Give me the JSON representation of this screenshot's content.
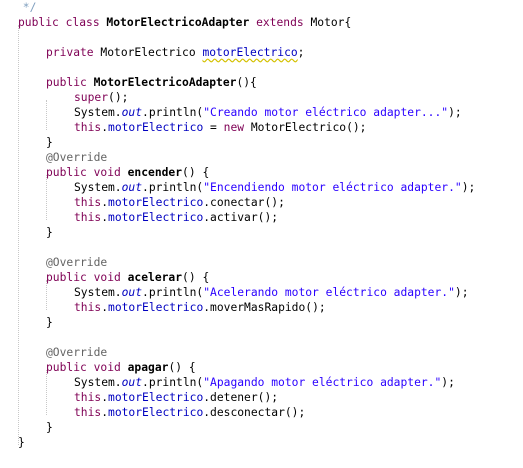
{
  "editor": {
    "lines": [
      {
        "indent": 0,
        "tokens": [
          {
            "t": " */",
            "c": "comment"
          }
        ]
      },
      {
        "indent": 0,
        "tokens": [
          {
            "t": "public class ",
            "c": "kw-plain"
          },
          {
            "t": "MotorElectricoAdapter",
            "c": "cls"
          },
          {
            "t": " ",
            "c": "plain"
          },
          {
            "t": "extends",
            "c": "kw-plain"
          },
          {
            "t": " Motor{",
            "c": "plain"
          }
        ]
      },
      {
        "indent": 0,
        "tokens": []
      },
      {
        "indent": 1,
        "tokens": [
          {
            "t": "private ",
            "c": "kw-plain"
          },
          {
            "t": "MotorElectrico ",
            "c": "plain"
          },
          {
            "t": "motorElectrico",
            "c": "field-warn"
          },
          {
            "t": ";",
            "c": "plain"
          }
        ]
      },
      {
        "indent": 0,
        "tokens": []
      },
      {
        "indent": 1,
        "tokens": [
          {
            "t": "public ",
            "c": "kw-plain"
          },
          {
            "t": "MotorElectricoAdapter",
            "c": "bold"
          },
          {
            "t": "(){",
            "c": "plain"
          }
        ]
      },
      {
        "indent": 2,
        "tokens": [
          {
            "t": "super",
            "c": "kw-plain"
          },
          {
            "t": "();",
            "c": "plain"
          }
        ]
      },
      {
        "indent": 2,
        "tokens": [
          {
            "t": "System.",
            "c": "plain"
          },
          {
            "t": "out",
            "c": "static"
          },
          {
            "t": ".println(",
            "c": "plain"
          },
          {
            "t": "\"Creando motor eléctrico adapter...\"",
            "c": "str"
          },
          {
            "t": ");",
            "c": "plain"
          }
        ]
      },
      {
        "indent": 2,
        "tokens": [
          {
            "t": "this",
            "c": "kw-plain"
          },
          {
            "t": ".",
            "c": "plain"
          },
          {
            "t": "motorElectrico",
            "c": "field"
          },
          {
            "t": " = ",
            "c": "plain"
          },
          {
            "t": "new",
            "c": "kw-plain"
          },
          {
            "t": " MotorElectrico();",
            "c": "plain"
          }
        ]
      },
      {
        "indent": 1,
        "tokens": [
          {
            "t": "}",
            "c": "plain"
          }
        ]
      },
      {
        "indent": 1,
        "tokens": [
          {
            "t": "@Override",
            "c": "ann"
          }
        ]
      },
      {
        "indent": 1,
        "tokens": [
          {
            "t": "public ",
            "c": "kw-plain"
          },
          {
            "t": "void ",
            "c": "kw-plain"
          },
          {
            "t": "encender",
            "c": "bold"
          },
          {
            "t": "() {",
            "c": "plain"
          }
        ]
      },
      {
        "indent": 2,
        "tokens": [
          {
            "t": "System.",
            "c": "plain"
          },
          {
            "t": "out",
            "c": "static"
          },
          {
            "t": ".println(",
            "c": "plain"
          },
          {
            "t": "\"Encendiendo motor eléctrico adapter.\"",
            "c": "str"
          },
          {
            "t": ");",
            "c": "plain"
          }
        ]
      },
      {
        "indent": 2,
        "tokens": [
          {
            "t": "this",
            "c": "kw-plain"
          },
          {
            "t": ".",
            "c": "plain"
          },
          {
            "t": "motorElectrico",
            "c": "field"
          },
          {
            "t": ".conectar();",
            "c": "plain"
          }
        ]
      },
      {
        "indent": 2,
        "tokens": [
          {
            "t": "this",
            "c": "kw-plain"
          },
          {
            "t": ".",
            "c": "plain"
          },
          {
            "t": "motorElectrico",
            "c": "field"
          },
          {
            "t": ".activar();",
            "c": "plain"
          }
        ]
      },
      {
        "indent": 1,
        "tokens": [
          {
            "t": "}",
            "c": "plain"
          }
        ]
      },
      {
        "indent": 0,
        "tokens": []
      },
      {
        "indent": 1,
        "tokens": [
          {
            "t": "@Override",
            "c": "ann"
          }
        ]
      },
      {
        "indent": 1,
        "tokens": [
          {
            "t": "public ",
            "c": "kw-plain"
          },
          {
            "t": "void ",
            "c": "kw-plain"
          },
          {
            "t": "acelerar",
            "c": "bold"
          },
          {
            "t": "() {",
            "c": "plain"
          }
        ]
      },
      {
        "indent": 2,
        "tokens": [
          {
            "t": "System.",
            "c": "plain"
          },
          {
            "t": "out",
            "c": "static"
          },
          {
            "t": ".println(",
            "c": "plain"
          },
          {
            "t": "\"Acelerando motor eléctrico adapter.\"",
            "c": "str"
          },
          {
            "t": ");",
            "c": "plain"
          }
        ]
      },
      {
        "indent": 2,
        "tokens": [
          {
            "t": "this",
            "c": "kw-plain"
          },
          {
            "t": ".",
            "c": "plain"
          },
          {
            "t": "motorElectrico",
            "c": "field"
          },
          {
            "t": ".moverMasRapido();",
            "c": "plain"
          }
        ]
      },
      {
        "indent": 1,
        "tokens": [
          {
            "t": "}",
            "c": "plain"
          }
        ]
      },
      {
        "indent": 0,
        "tokens": []
      },
      {
        "indent": 1,
        "tokens": [
          {
            "t": "@Override",
            "c": "ann"
          }
        ]
      },
      {
        "indent": 1,
        "tokens": [
          {
            "t": "public ",
            "c": "kw-plain"
          },
          {
            "t": "void ",
            "c": "kw-plain"
          },
          {
            "t": "apagar",
            "c": "bold"
          },
          {
            "t": "() {",
            "c": "plain"
          }
        ]
      },
      {
        "indent": 2,
        "tokens": [
          {
            "t": "System.",
            "c": "plain"
          },
          {
            "t": "out",
            "c": "static"
          },
          {
            "t": ".println(",
            "c": "plain"
          },
          {
            "t": "\"Apagando motor eléctrico adapter.\"",
            "c": "str"
          },
          {
            "t": ");",
            "c": "plain"
          }
        ]
      },
      {
        "indent": 2,
        "tokens": [
          {
            "t": "this",
            "c": "kw-plain"
          },
          {
            "t": ".",
            "c": "plain"
          },
          {
            "t": "motorElectrico",
            "c": "field"
          },
          {
            "t": ".detener();",
            "c": "plain"
          }
        ]
      },
      {
        "indent": 2,
        "tokens": [
          {
            "t": "this",
            "c": "kw-plain"
          },
          {
            "t": ".",
            "c": "plain"
          },
          {
            "t": "motorElectrico",
            "c": "field"
          },
          {
            "t": ".desconectar();",
            "c": "plain"
          }
        ]
      },
      {
        "indent": 1,
        "tokens": [
          {
            "t": "}",
            "c": "plain"
          }
        ]
      },
      {
        "indent": 0,
        "tokens": [
          {
            "t": "}",
            "c": "plain"
          }
        ]
      }
    ]
  },
  "colors": {
    "keyword": "#7f0055",
    "field": "#0000c0",
    "string": "#2a00ff",
    "comment": "#7f9fbf",
    "annotation": "#646464",
    "warning_underline": "#d4c100"
  }
}
